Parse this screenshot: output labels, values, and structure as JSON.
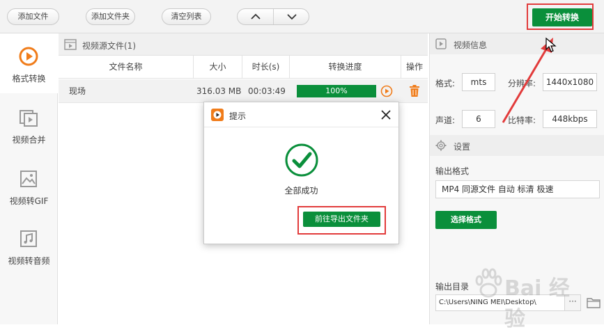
{
  "toolbar": {
    "add_file": "添加文件",
    "add_folder": "添加文件夹",
    "clear_list": "清空列表",
    "start_convert": "开始转换"
  },
  "sidebar": {
    "items": [
      {
        "label": "格式转换",
        "icon": "play-circle-icon",
        "active": true
      },
      {
        "label": "视频合并",
        "icon": "video-merge-icon",
        "active": false
      },
      {
        "label": "视频转GIF",
        "icon": "image-icon",
        "active": false
      },
      {
        "label": "视频转音频",
        "icon": "music-note-icon",
        "active": false
      }
    ]
  },
  "file_list": {
    "section_title": "视频源文件(1)",
    "columns": [
      "文件名称",
      "大小",
      "时长(s)",
      "转换进度",
      "操作"
    ],
    "rows": [
      {
        "name": "现场",
        "size": "316.03 MB",
        "duration": "00:03:49",
        "progress_text": "100%",
        "progress": 1.0
      }
    ]
  },
  "video_info": {
    "section_title": "视频信息",
    "format_label": "格式:",
    "format_value": "mts",
    "resolution_label": "分辨率:",
    "resolution_value": "1440x1080",
    "channel_label": "声道:",
    "channel_value": "6",
    "bitrate_label": "比特率:",
    "bitrate_value": "448kbps"
  },
  "settings": {
    "section_title": "设置",
    "output_format_label": "输出格式",
    "output_format_value": "MP4 同源文件 自动 标清 极速",
    "choose_format": "选择格式",
    "output_dir_label": "输出目录",
    "output_dir_value": "C:\\Users\\NING MEI\\Desktop\\",
    "browse": "···"
  },
  "dialog": {
    "title": "提示",
    "message": "全部成功",
    "goto_folder": "前往导出文件夹"
  },
  "watermark": {
    "text": "Bai 经验"
  },
  "colors": {
    "accent_green": "#0a8f3b",
    "brand_orange": "#f07c1a",
    "highlight_red": "#e23b3b"
  }
}
